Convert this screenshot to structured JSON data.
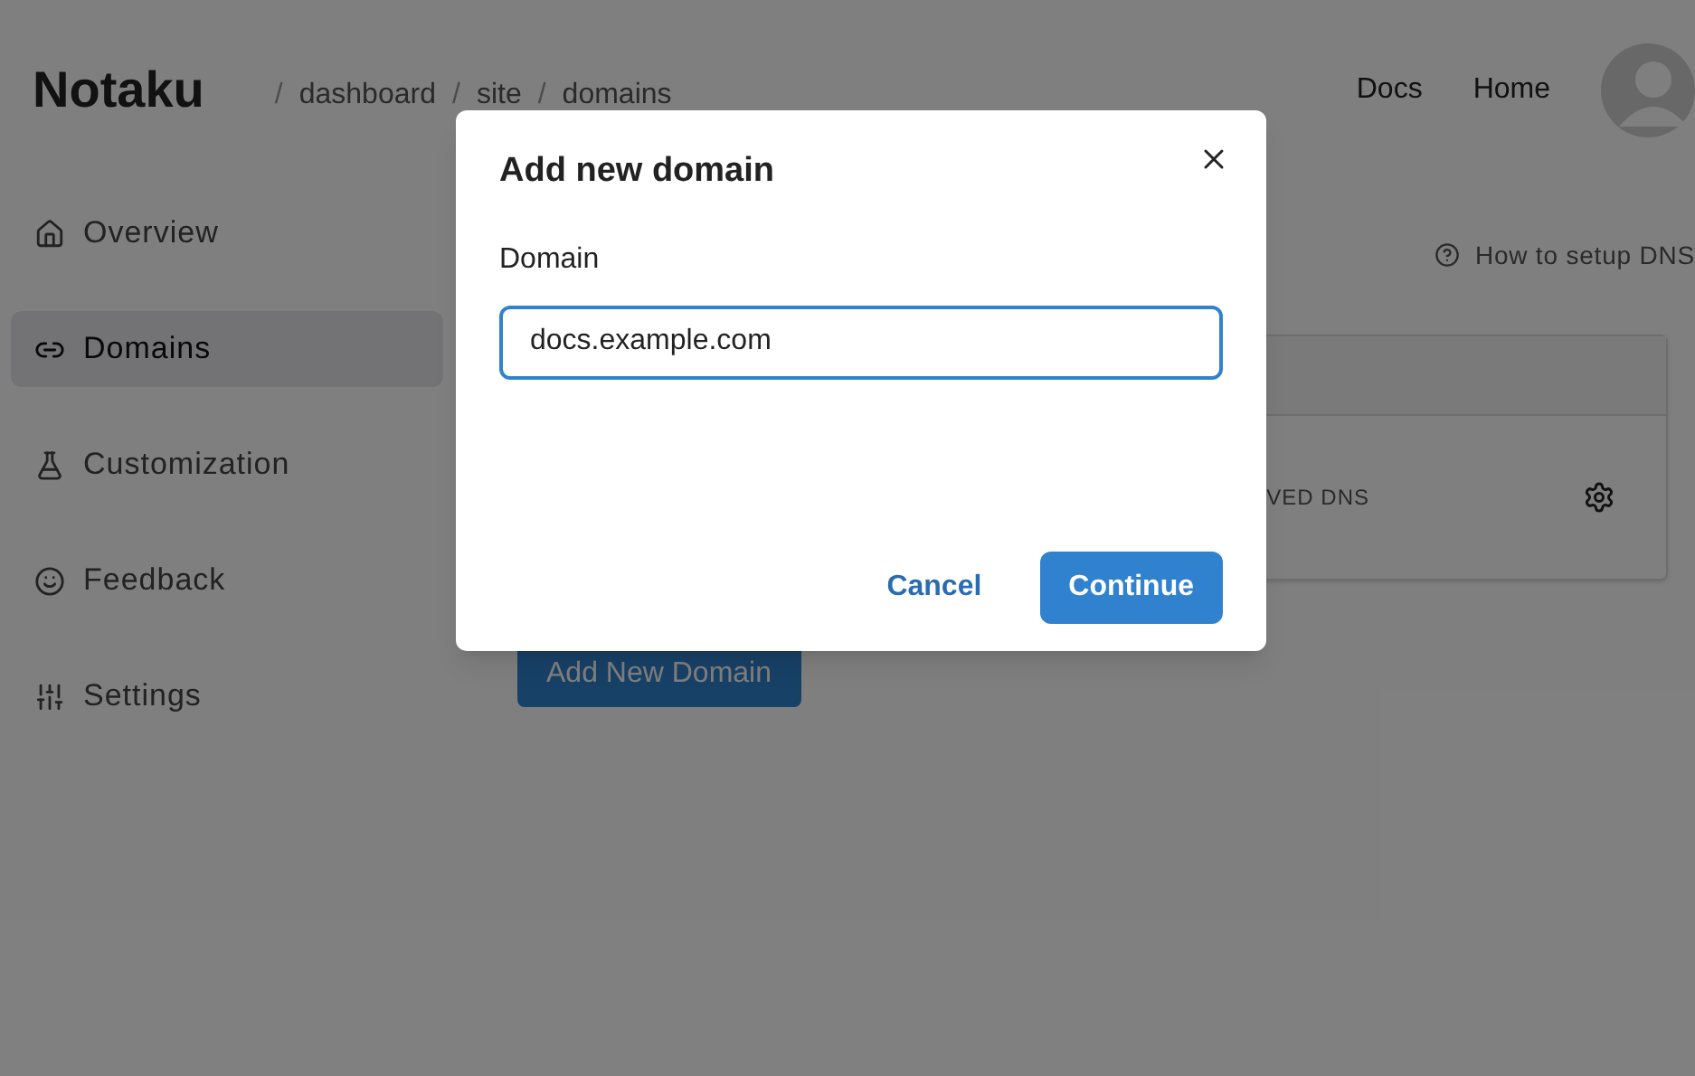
{
  "header": {
    "logo": "Notaku",
    "breadcrumb": [
      {
        "separator": "/",
        "label": "dashboard"
      },
      {
        "separator": "/",
        "label": "site"
      },
      {
        "separator": "/",
        "label": "domains"
      }
    ],
    "nav": [
      "Docs",
      "Home"
    ]
  },
  "sidebar": {
    "items": [
      {
        "label": "Overview",
        "selected": false
      },
      {
        "label": "Domains",
        "selected": true
      },
      {
        "label": "Customization",
        "selected": false
      },
      {
        "label": "Feedback",
        "selected": false
      },
      {
        "label": "Settings",
        "selected": false
      }
    ]
  },
  "main": {
    "help_link": "How to setup DNS",
    "domain_row": {
      "status": "VED DNS"
    },
    "add_button": "Add New Domain"
  },
  "dialog": {
    "title": "Add new domain",
    "field_label": "Domain",
    "field_value": "docs.example.com",
    "buttons": [
      {
        "label": "Cancel",
        "kind": "link"
      },
      {
        "label": "Continue",
        "kind": "primary"
      }
    ]
  }
}
